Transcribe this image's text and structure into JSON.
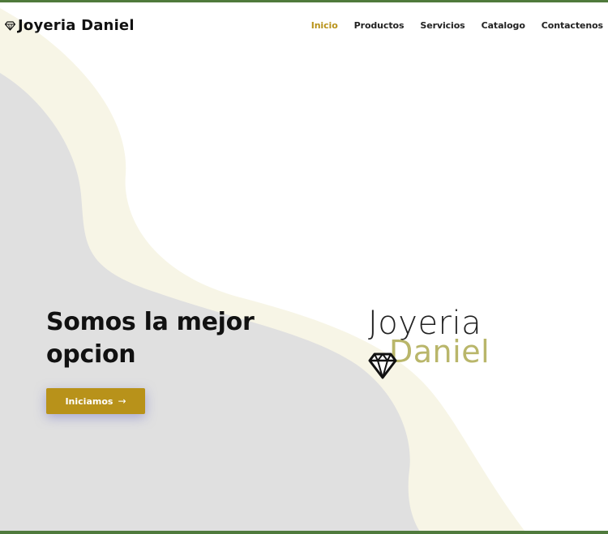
{
  "header": {
    "brand": "Joyeria Daniel",
    "brand_icon": "diamond-icon",
    "nav": [
      {
        "label": "Inicio",
        "active": true
      },
      {
        "label": "Productos",
        "active": false
      },
      {
        "label": "Servicios",
        "active": false
      },
      {
        "label": "Catalogo",
        "active": false
      },
      {
        "label": "Contactenos",
        "active": false
      }
    ]
  },
  "hero": {
    "title": "Somos la mejor opcion",
    "cta_label": "Iniciamos",
    "cta_icon": "arrow-right-icon"
  },
  "logo": {
    "line1": "Joyeria",
    "line2": "Daniel",
    "icon": "diamond-icon"
  },
  "colors": {
    "accent": "#b8921a",
    "frame": "#4f7a3c",
    "blob_gray": "#e0e0e0",
    "blob_cream": "#f7f5e6",
    "logo_secondary": "#b9b66a"
  }
}
